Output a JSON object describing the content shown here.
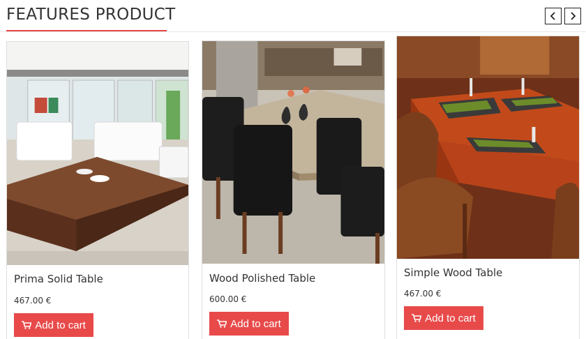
{
  "section": {
    "title": "FEATURES PRODUCT",
    "accent_color": "#e64646",
    "nav": {
      "prev_icon": "chevron-left-icon",
      "next_icon": "chevron-right-icon"
    }
  },
  "products": [
    {
      "name": "Prima Solid Table",
      "price": "467.00 €",
      "cart_label": "Add to cart",
      "image": "dark wood coffee table in bright lounge with white armchairs"
    },
    {
      "name": "Wood Polished Table",
      "price": "600.00 €",
      "cart_label": "Add to cart",
      "image": "light wood dining table with black leather chairs"
    },
    {
      "name": "Simple Wood Table",
      "price": "467.00 €",
      "cart_label": "Add to cart",
      "image": "orange wood restaurant tables with rattan chairs"
    }
  ],
  "button_color": "#e84a4a"
}
